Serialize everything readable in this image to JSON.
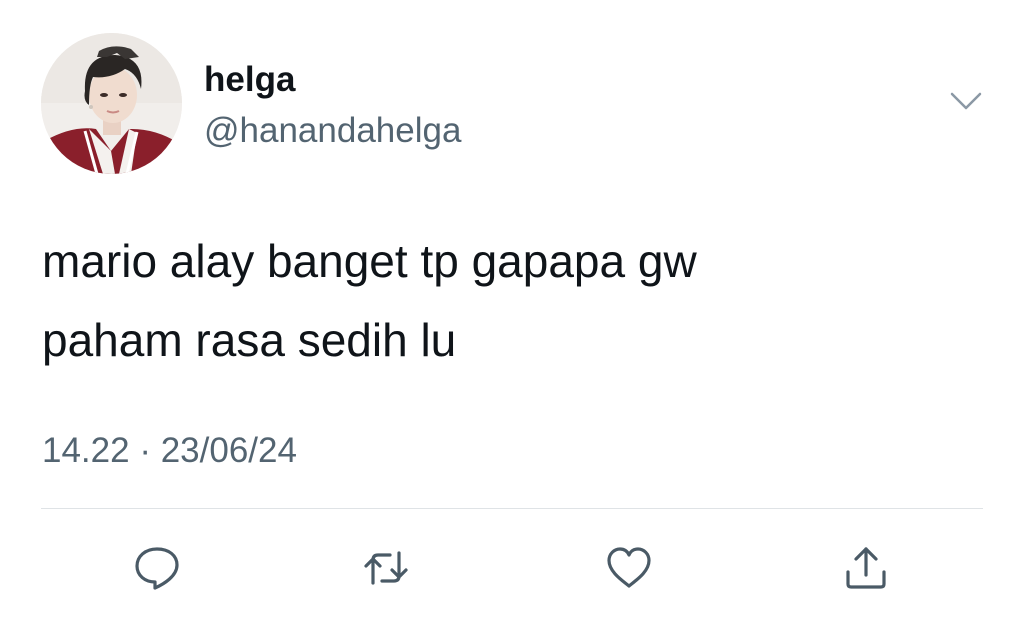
{
  "tweet": {
    "author": {
      "display_name": "helga",
      "handle": "@hanandahelga"
    },
    "text_lines": [
      "mario alay banget tp gapapa gw",
      "paham rasa sedih lu"
    ],
    "time": "14.22",
    "separator": "·",
    "date": "23/06/24"
  },
  "icons": {
    "more": "chevron-down-icon",
    "reply": "reply-icon",
    "retweet": "retweet-icon",
    "like": "heart-icon",
    "share": "share-icon"
  },
  "colors": {
    "text_primary": "#0f1419",
    "text_secondary": "#536471",
    "icon": "#4a5a66",
    "divider": "#dfe3e6",
    "jacket": "#8a1f2b"
  }
}
